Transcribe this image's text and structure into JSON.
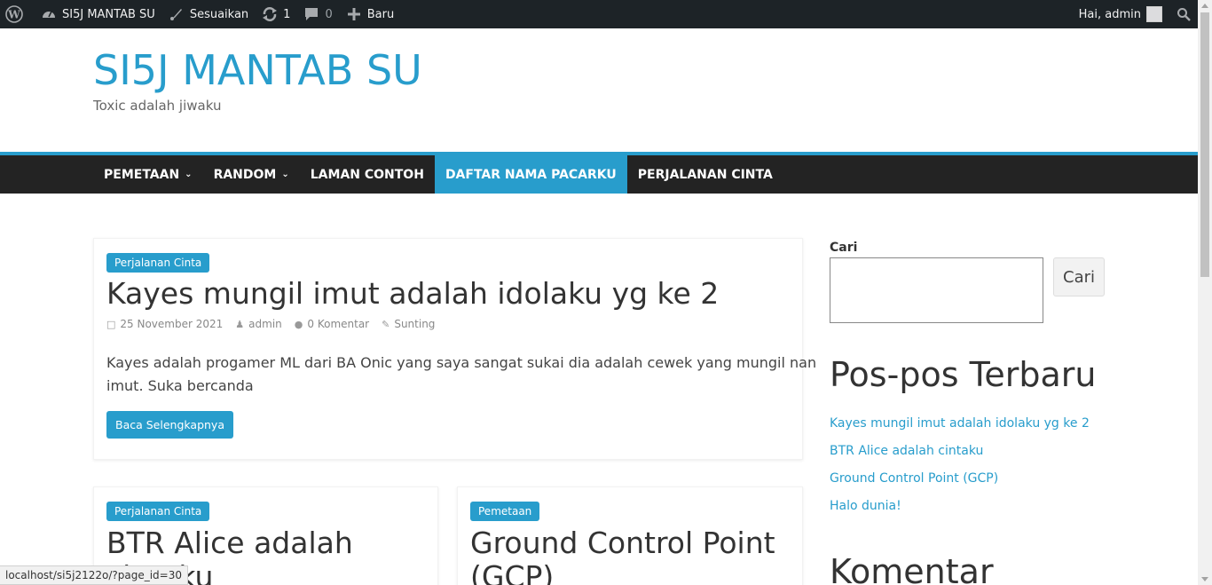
{
  "adminbar": {
    "site_name": "SI5J MANTAB SU",
    "customize": "Sesuaikan",
    "updates_count": "1",
    "comments_count": "0",
    "new_label": "Baru",
    "greeting": "Hai, admin"
  },
  "header": {
    "title": "SI5J MANTAB SU",
    "description": "Toxic adalah jiwaku"
  },
  "nav": {
    "items": [
      {
        "label": "PEMETAAN",
        "has_dropdown": true
      },
      {
        "label": "RANDOM",
        "has_dropdown": true
      },
      {
        "label": "LAMAN CONTOH",
        "has_dropdown": false
      },
      {
        "label": "DAFTAR NAMA PACARKU",
        "has_dropdown": false,
        "active": true
      },
      {
        "label": "PERJALANAN CINTA",
        "has_dropdown": false
      }
    ]
  },
  "main_post": {
    "category": "Perjalanan Cinta",
    "title": "Kayes mungil imut adalah idolaku yg ke 2",
    "date": "25 November 2021",
    "author": "admin",
    "comments": "0 Komentar",
    "edit": "Sunting",
    "excerpt_line1": "Kayes adalah progamer ML dari BA Onic yang saya sangat sukai dia adalah cewek yang mungil nan",
    "excerpt_line2": "imut. Suka bercanda",
    "read_more": "Baca Selengkapnya"
  },
  "post2": {
    "category": "Perjalanan Cinta",
    "title_line1": "BTR Alice adalah",
    "title_line2": "cintaku"
  },
  "post3": {
    "category": "Pemetaan",
    "title_line1": "Ground Control Point",
    "title_line2": "(GCP)"
  },
  "sidebar": {
    "search_label": "Cari",
    "search_button": "Cari",
    "recent_title": "Pos-pos Terbaru",
    "recent_posts": [
      "Kayes mungil imut adalah idolaku yg ke 2",
      "BTR Alice adalah cintaku",
      "Ground Control Point (GCP)",
      "Halo dunia!"
    ],
    "comments_title": "Komentar"
  },
  "statusbar": {
    "url": "localhost/si5j2122o/?page_id=30"
  },
  "colors": {
    "accent": "#289dcc",
    "adminbar": "#1d2327",
    "nav": "#232323"
  }
}
